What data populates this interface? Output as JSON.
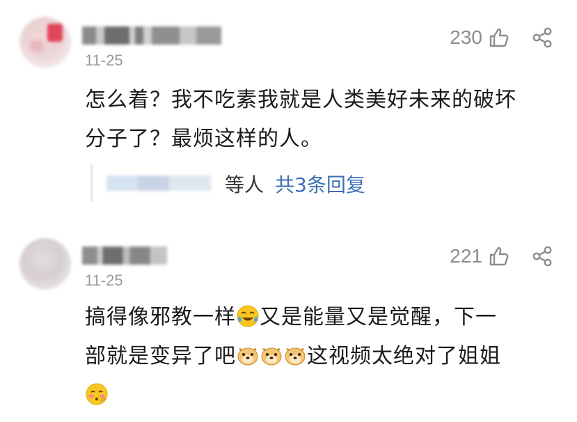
{
  "comments": [
    {
      "date": "11-25",
      "likes": "230",
      "lines": [
        "怎么着？我不吃素我就是人类美好未来的破坏",
        "分子了？最烦这样的人。"
      ],
      "reply": {
        "suffix": "等人",
        "count_label": "共3条回复"
      }
    },
    {
      "date": "11-25",
      "likes": "221",
      "line1_a": "搞得像邪教一样",
      "line1_b": "又是能量又是觉醒，下一",
      "line2_a": "部就是变异了吧",
      "line2_b": "这视频太绝对了姐姐"
    }
  ],
  "icons": {
    "like": "thumbs-up-icon",
    "share": "share-icon",
    "emoji_laugh": "laughing-tears-emoji",
    "emoji_doge": "doge-emoji",
    "emoji_blush": "blushing-emoji"
  },
  "colors": {
    "link": "#3c6fb6",
    "meta": "#9a9a9a",
    "text": "#1a1a1a"
  }
}
